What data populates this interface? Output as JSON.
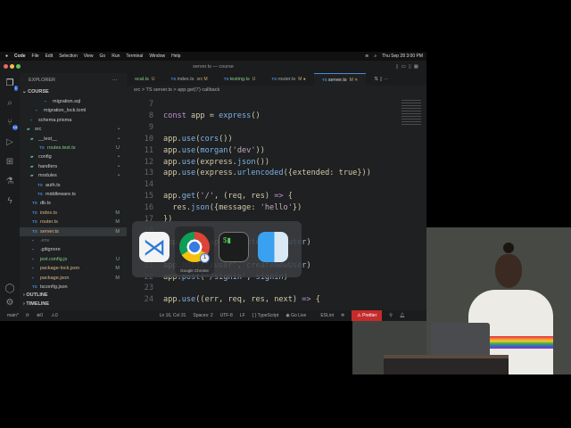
{
  "menubar": {
    "items": [
      "Code",
      "File",
      "Edit",
      "Selection",
      "View",
      "Go",
      "Run",
      "Terminal",
      "Window",
      "Help"
    ],
    "clock": "Thu Sep 28  3:00 PM"
  },
  "window": {
    "title": "server.ts — course"
  },
  "activity": {
    "explorer_badge": "1",
    "scm_badge": "14"
  },
  "sidebar": {
    "header": "EXPLORER",
    "root": "COURSE",
    "items": [
      {
        "label": "migration.sql",
        "icon": "database-icon",
        "status": ""
      },
      {
        "label": "migration_lock.toml",
        "icon": "toml-icon",
        "status": ""
      },
      {
        "label": "schema.prisma",
        "icon": "prisma-icon",
        "status": ""
      },
      {
        "label": "src",
        "icon": "folder-icon",
        "status": "•"
      },
      {
        "label": "__test__",
        "icon": "folder-icon",
        "status": "•"
      },
      {
        "label": "routes.test.ts",
        "icon": "ts-icon",
        "status": "U"
      },
      {
        "label": "config",
        "icon": "folder-icon",
        "status": "•"
      },
      {
        "label": "handlers",
        "icon": "folder-icon",
        "status": "•"
      },
      {
        "label": "modules",
        "icon": "folder-icon",
        "status": "•"
      },
      {
        "label": "auth.ts",
        "icon": "ts-icon",
        "status": ""
      },
      {
        "label": "middleware.ts",
        "icon": "ts-icon",
        "status": ""
      },
      {
        "label": "db.ts",
        "icon": "ts-icon",
        "status": ""
      },
      {
        "label": "index.ts",
        "icon": "ts-icon",
        "status": "M"
      },
      {
        "label": "router.ts",
        "icon": "ts-icon",
        "status": "M"
      },
      {
        "label": "server.ts",
        "icon": "ts-icon",
        "status": "M"
      },
      {
        "label": ".env",
        "icon": "gear-icon",
        "status": ""
      },
      {
        "label": ".gitignore",
        "icon": "git-icon",
        "status": ""
      },
      {
        "label": "jest.config.js",
        "icon": "js-icon",
        "status": "U"
      },
      {
        "label": "package-lock.json",
        "icon": "json-icon",
        "status": "M"
      },
      {
        "label": "package.json",
        "icon": "json-icon",
        "status": "M"
      },
      {
        "label": "tsconfig.json",
        "icon": "ts-icon",
        "status": ""
      }
    ],
    "outline": "OUTLINE",
    "timeline": "TIMELINE"
  },
  "tabs": [
    {
      "label": "ocal.ts",
      "meta": "U"
    },
    {
      "label": "index.ts",
      "meta": "src M"
    },
    {
      "label": "testing.ts",
      "meta": "U"
    },
    {
      "label": "router.ts",
      "meta": "M ●"
    },
    {
      "label": "server.ts",
      "meta": "M ✕"
    }
  ],
  "breadcrumb": [
    "src",
    ">",
    "TS server.ts",
    ">",
    "app.get('/') callback"
  ],
  "code": [
    {
      "n": "7",
      "t": ""
    },
    {
      "n": "8",
      "t": "const app = express()"
    },
    {
      "n": "9",
      "t": ""
    },
    {
      "n": "10",
      "t": "app.use(cors())"
    },
    {
      "n": "11",
      "t": "app.use(morgan('dev'))"
    },
    {
      "n": "12",
      "t": "app.use(express.json())"
    },
    {
      "n": "13",
      "t": "app.use(express.urlencoded({extended: true}))"
    },
    {
      "n": "14",
      "t": ""
    },
    {
      "n": "15",
      "t": "app.get('/', (req, res) => {"
    },
    {
      "n": "16",
      "t": "  res.json({message: 'hello'})"
    },
    {
      "n": "17",
      "t": "})"
    },
    {
      "n": "18",
      "t": ""
    },
    {
      "n": "19",
      "t": "app.use('/api', protect, router)"
    },
    {
      "n": "20",
      "t": ""
    },
    {
      "n": "21",
      "t": "app.post('/user', createNewUser)"
    },
    {
      "n": "22",
      "t": "app.post('/signin', signin)"
    },
    {
      "n": "23",
      "t": ""
    },
    {
      "n": "24",
      "t": "app.use((err, req, res, next) => {"
    }
  ],
  "switcher": {
    "selected_label": "Google Chrome",
    "chrome_badge": "1"
  },
  "status": {
    "branch": "main*",
    "errors": "0",
    "warnings": "0",
    "position": "Ln 16, Col 31",
    "spaces": "Spaces: 2",
    "encoding": "UTF-8",
    "eol": "LF",
    "language": "{ } TypeScript",
    "golive": "Go Live",
    "eslint": "ESLint",
    "prettier": "⚠ Prettier"
  }
}
